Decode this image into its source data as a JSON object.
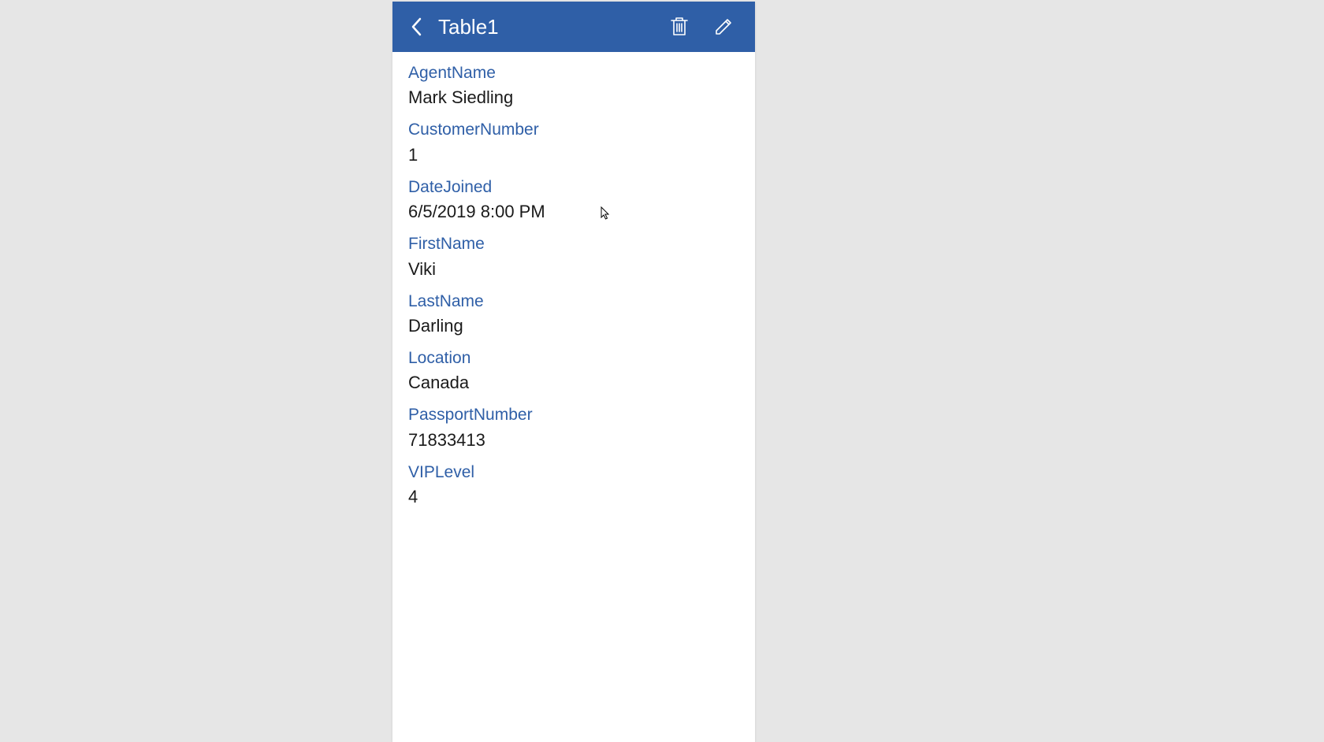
{
  "header": {
    "title": "Table1"
  },
  "fields": [
    {
      "label": "AgentName",
      "value": "Mark Siedling"
    },
    {
      "label": "CustomerNumber",
      "value": "1"
    },
    {
      "label": "DateJoined",
      "value": "6/5/2019 8:00 PM"
    },
    {
      "label": "FirstName",
      "value": "Viki"
    },
    {
      "label": "LastName",
      "value": "Darling"
    },
    {
      "label": "Location",
      "value": "Canada"
    },
    {
      "label": "PassportNumber",
      "value": "71833413"
    },
    {
      "label": "VIPLevel",
      "value": "4"
    }
  ]
}
